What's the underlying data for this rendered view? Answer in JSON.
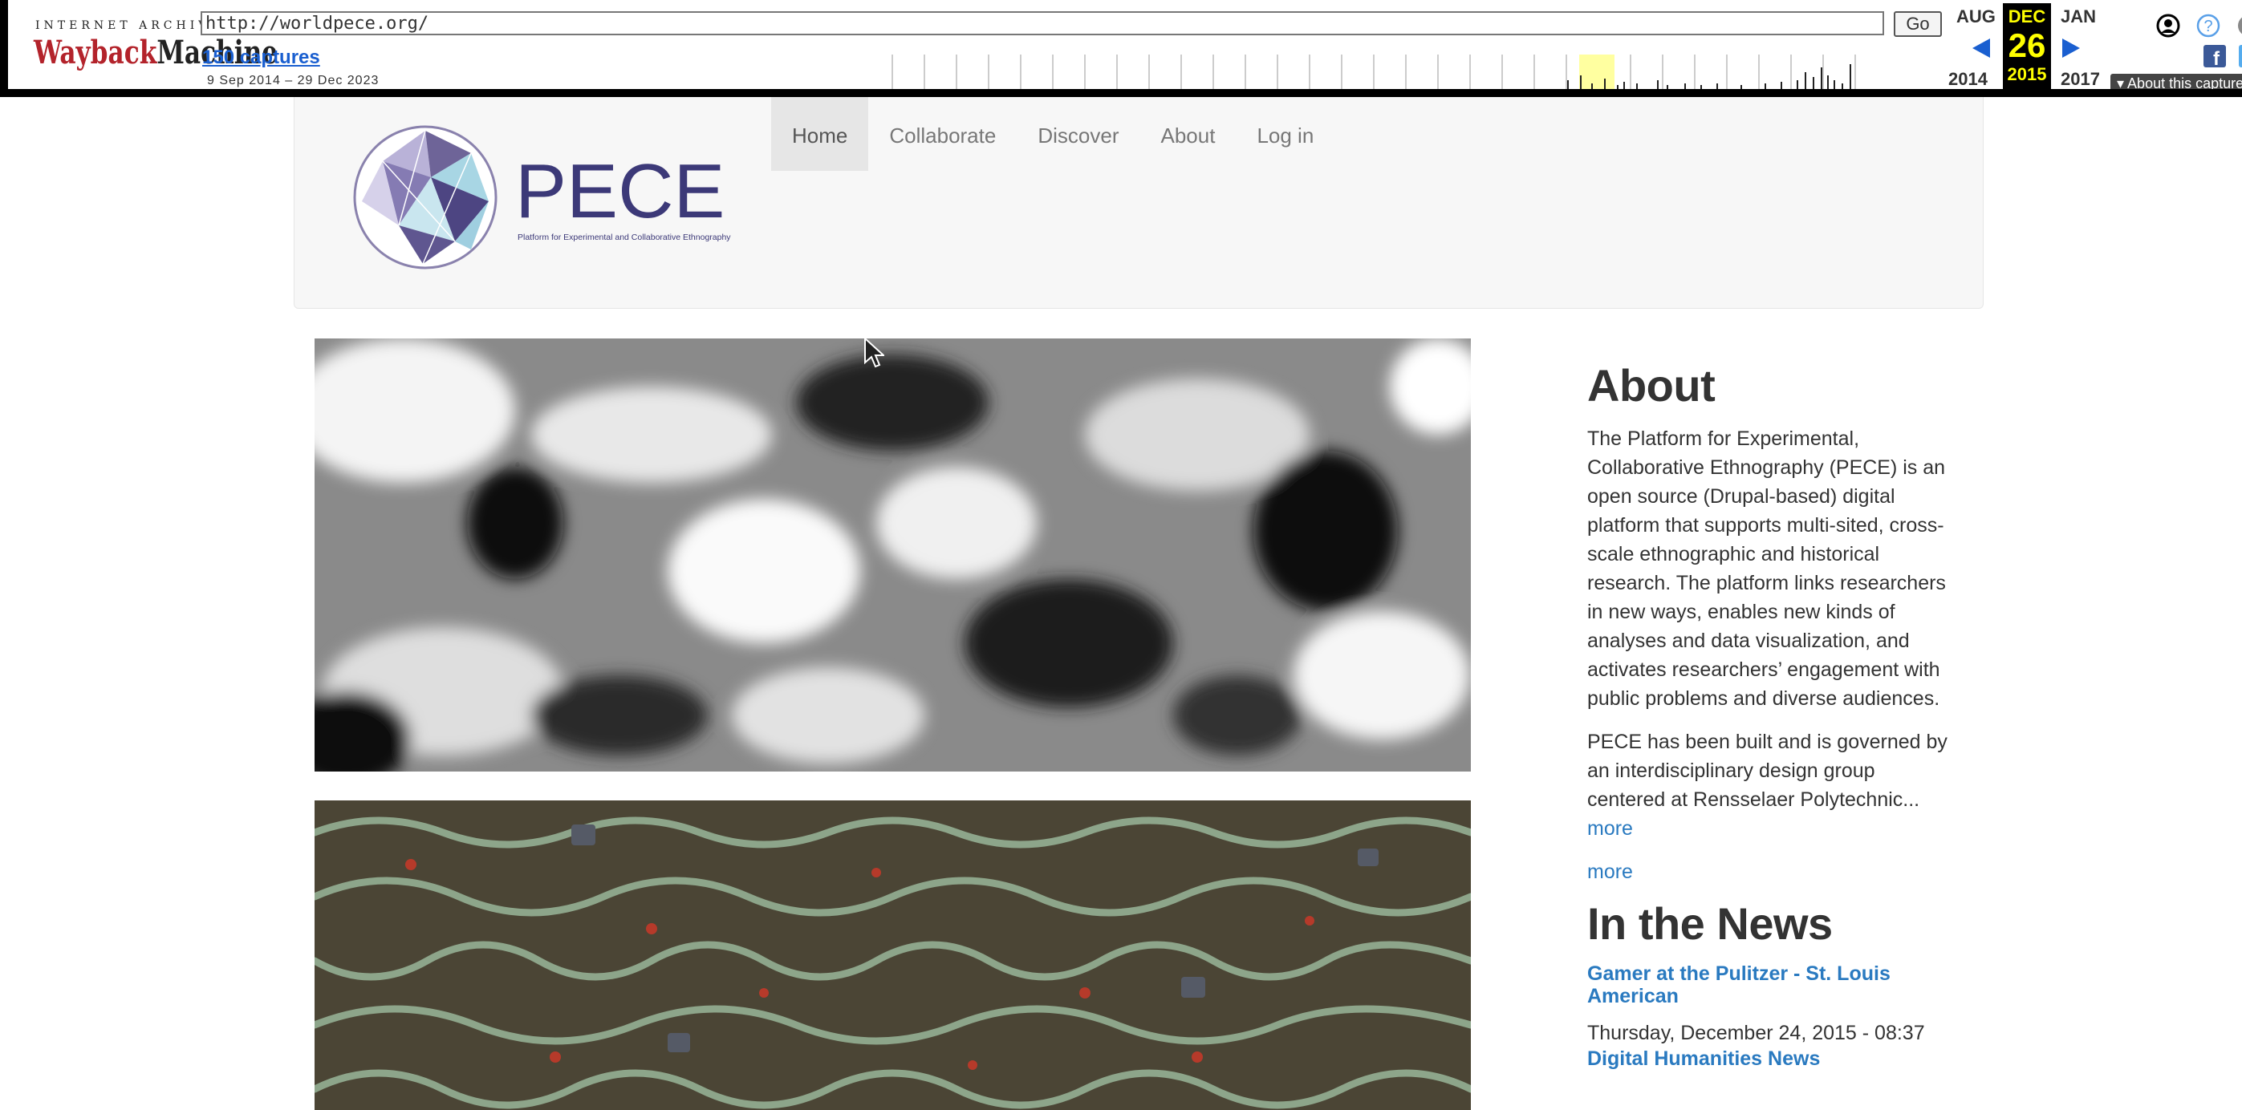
{
  "wayback": {
    "logo_top": "INTERNET ARCHIVE",
    "logo_main_a": "Wayback",
    "logo_main_b": "Machine",
    "url": "http://worldpece.org/",
    "go_label": "Go",
    "captures": "150 captures",
    "range": "9 Sep 2014 – 29 Dec 2023",
    "prev_month": "AUG",
    "prev_year": "2014",
    "current_month": "DEC",
    "current_day": "26",
    "current_year": "2015",
    "next_month": "JAN",
    "next_year": "2017",
    "about_capture": "About this capture",
    "colors": {
      "current_bg": "#000000",
      "current_fg": "#ffff00",
      "arrow": "#1a5fd0"
    }
  },
  "site": {
    "logo_text": "PECE",
    "logo_subtitle": "Platform for Experimental and Collaborative Ethnography",
    "nav": [
      {
        "label": "Home",
        "active": true
      },
      {
        "label": "Collaborate",
        "active": false
      },
      {
        "label": "Discover",
        "active": false
      },
      {
        "label": "About",
        "active": false
      },
      {
        "label": "Log in",
        "active": false
      }
    ]
  },
  "sidebar": {
    "about_title": "About",
    "about_p1": "The Platform for Experimental, Collaborative Ethnography (PECE) is an open source (Drupal-based) digital platform that supports multi-sited, cross-scale ethnographic and historical research. The platform links researchers in new ways,  enables new kinds of analyses and data visualization, and activates researchers’ engagement with public problems and diverse audiences.",
    "about_p2": "PECE has been built and is governed by an interdisciplinary design group centered at Rensselaer Polytechnic...",
    "more_1": "more",
    "more_2": "more",
    "news_title": "In the News",
    "news_item_1_title": "Gamer at the Pulitzer - St. Louis American",
    "news_item_1_date": "Thursday, December 24, 2015 - 08:37",
    "news_item_2_title": "Digital Humanities News"
  },
  "colors": {
    "link": "#2a7ac0",
    "header_bg": "#f7f7f7",
    "nav_active_bg": "#e6e6e6"
  }
}
